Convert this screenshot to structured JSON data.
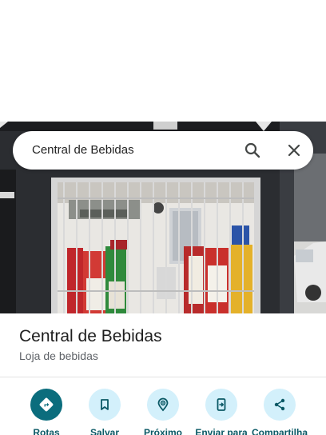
{
  "search": {
    "query": "Central de Bebidas",
    "search_icon": "search-icon",
    "close_icon": "close-icon"
  },
  "photo": {
    "subject": "store-front-photo"
  },
  "place": {
    "title": "Central de Bebidas",
    "category": "Loja de bebidas"
  },
  "actions": [
    {
      "label": "Rotas",
      "icon": "directions-icon"
    },
    {
      "label": "Salvar",
      "icon": "bookmark-icon"
    },
    {
      "label": "Próximo",
      "icon": "nearby-icon"
    },
    {
      "label": "Enviar para",
      "icon": "send-to-phone-icon"
    },
    {
      "label": "Compartilha",
      "icon": "share-icon"
    }
  ],
  "colors": {
    "primary_action": "#0b6d7d",
    "action_circle": "#d3f0fb",
    "action_label": "#0b5966"
  }
}
